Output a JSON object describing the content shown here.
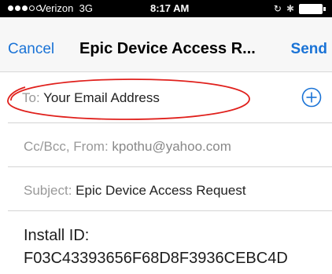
{
  "status_bar": {
    "signal_bars": 5,
    "signal_filled": 3,
    "carrier": "Verizon",
    "network": "3G",
    "time": "8:17 AM",
    "icons": [
      "rotation-lock-icon",
      "bluetooth-icon",
      "battery-icon"
    ],
    "battery_level": 1.0
  },
  "nav": {
    "cancel_label": "Cancel",
    "title": "Epic Device Access R...",
    "send_label": "Send"
  },
  "fields": {
    "to_label": "To:",
    "to_value": "Your Email Address",
    "cc_label": "Cc/Bcc, From:",
    "cc_value": "kpothu@yahoo.com",
    "subject_label": "Subject:",
    "subject_value": "Epic Device Access Request"
  },
  "body": {
    "install_label": "Install ID:",
    "install_id": "F03C43393656F68D8F3936CEBC4D"
  },
  "colors": {
    "accent": "#1a73d6",
    "annotation": "#e0201c",
    "status_bar_bg": "#000000"
  }
}
